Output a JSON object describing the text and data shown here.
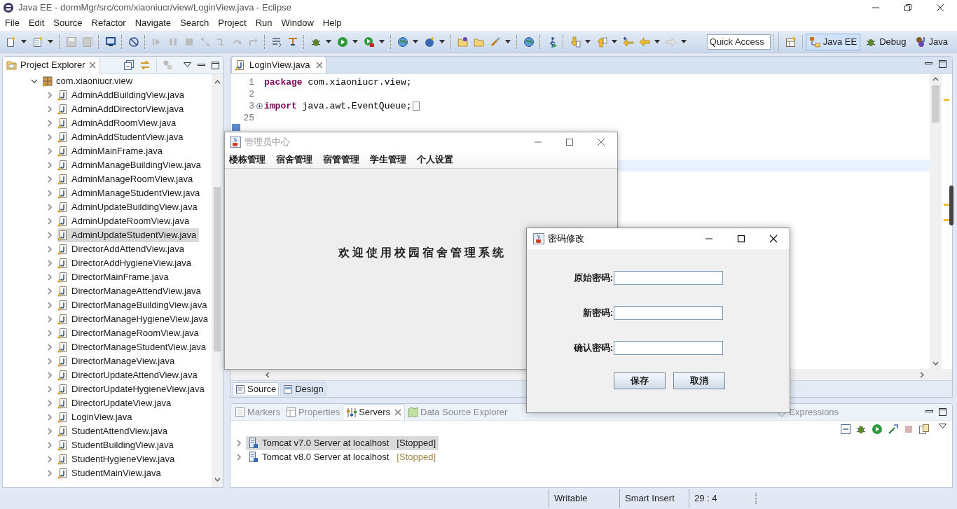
{
  "window": {
    "title": "Java EE - dormMgr/src/com/xiaoniucr/view/LoginView.java - Eclipse"
  },
  "menu_bar": [
    "File",
    "Edit",
    "Source",
    "Refactor",
    "Navigate",
    "Search",
    "Project",
    "Run",
    "Window",
    "Help"
  ],
  "toolbar": {
    "quick_access": {
      "placeholder": "Quick Access"
    },
    "perspectives": [
      {
        "label": "Java EE",
        "selected": true
      },
      {
        "label": "Debug",
        "selected": false
      },
      {
        "label": "Java",
        "selected": false
      }
    ]
  },
  "project_explorer": {
    "title": "Project Explorer",
    "tree": [
      {
        "label": "com.xiaoniucr.view",
        "kind": "package",
        "expanded": true,
        "selected": false,
        "children": [
          {
            "label": "AdminAddBuildingView.java",
            "kind": "file",
            "expanded": false,
            "selected": false
          },
          {
            "label": "AdminAddDirectorView.java",
            "kind": "file",
            "expanded": false,
            "selected": false
          },
          {
            "label": "AdminAddRoomView.java",
            "kind": "file",
            "expanded": false,
            "selected": false
          },
          {
            "label": "AdminAddStudentView.java",
            "kind": "file",
            "expanded": false,
            "selected": false
          },
          {
            "label": "AdminMainFrame.java",
            "kind": "file",
            "expanded": false,
            "selected": false
          },
          {
            "label": "AdminManageBuildingView.java",
            "kind": "file",
            "expanded": false,
            "selected": false
          },
          {
            "label": "AdminManageRoomView.java",
            "kind": "file",
            "expanded": false,
            "selected": false
          },
          {
            "label": "AdminManageStudentView.java",
            "kind": "file",
            "expanded": false,
            "selected": false
          },
          {
            "label": "AdminUpdateBuildingView.java",
            "kind": "file",
            "expanded": false,
            "selected": false
          },
          {
            "label": "AdminUpdateRoomView.java",
            "kind": "file",
            "expanded": false,
            "selected": false
          },
          {
            "label": "AdminUpdateStudentView.java",
            "kind": "file",
            "expanded": false,
            "selected": true
          },
          {
            "label": "DirectorAddAttendView.java",
            "kind": "file",
            "expanded": false,
            "selected": false
          },
          {
            "label": "DirectorAddHygieneView.java",
            "kind": "file",
            "expanded": false,
            "selected": false
          },
          {
            "label": "DirectorMainFrame.java",
            "kind": "file",
            "expanded": false,
            "selected": false
          },
          {
            "label": "DirectorManageAttendView.java",
            "kind": "file",
            "expanded": false,
            "selected": false
          },
          {
            "label": "DirectorManageBuildingView.java",
            "kind": "file",
            "expanded": false,
            "selected": false
          },
          {
            "label": "DirectorManageHygieneView.java",
            "kind": "file",
            "expanded": false,
            "selected": false
          },
          {
            "label": "DirectorManageRoomView.java",
            "kind": "file",
            "expanded": false,
            "selected": false
          },
          {
            "label": "DirectorManageStudentView.java",
            "kind": "file",
            "expanded": false,
            "selected": false
          },
          {
            "label": "DirectorManageView.java",
            "kind": "file",
            "expanded": false,
            "selected": false
          },
          {
            "label": "DirectorUpdateAttendView.java",
            "kind": "file",
            "expanded": false,
            "selected": false
          },
          {
            "label": "DirectorUpdateHygieneView.java",
            "kind": "file",
            "expanded": false,
            "selected": false
          },
          {
            "label": "DirectorUpdateView.java",
            "kind": "file",
            "expanded": false,
            "selected": false
          },
          {
            "label": "LoginView.java",
            "kind": "file",
            "expanded": false,
            "selected": false
          },
          {
            "label": "StudentAttendView.java",
            "kind": "file",
            "expanded": false,
            "selected": false
          },
          {
            "label": "StudentBuildingView.java",
            "kind": "file",
            "expanded": false,
            "selected": false
          },
          {
            "label": "StudentHygieneView.java",
            "kind": "file",
            "expanded": false,
            "selected": false
          },
          {
            "label": "StudentMainView.java",
            "kind": "file",
            "expanded": false,
            "selected": false
          }
        ]
      }
    ]
  },
  "editor": {
    "tabs": [
      {
        "label": "LoginView.java",
        "selected": true
      }
    ],
    "lines": [
      {
        "number": "1",
        "folded": false,
        "tokens": [
          {
            "kind": "keyword",
            "text": "package"
          },
          {
            "kind": "plain",
            "text": " com.xiaoniucr.view;"
          }
        ]
      },
      {
        "number": "2",
        "folded": false
      },
      {
        "number": "3",
        "folded": true,
        "tokens": [
          {
            "kind": "keyword",
            "text": "import"
          },
          {
            "kind": "plain",
            "text": " java.awt.EventQueue;"
          }
        ]
      },
      {
        "number": "25",
        "folded": false
      }
    ],
    "view_tabs": [
      {
        "label": "Source",
        "selected": true
      },
      {
        "label": "Design",
        "selected": false
      }
    ]
  },
  "bottom_panel": {
    "tabs": [
      {
        "label": "Markers",
        "selected": false
      },
      {
        "label": "Properties",
        "selected": false
      },
      {
        "label": "Servers",
        "selected": true
      },
      {
        "label": "Data Source Explorer",
        "selected": false
      },
      {
        "label": "Expressions",
        "selected": false
      }
    ],
    "servers": [
      {
        "label": "Tomcat v7.0 Server at localhost",
        "status": "[Stopped]",
        "selected": true
      },
      {
        "label": "Tomcat v8.0 Server at localhost",
        "status": "[Stopped]",
        "selected": false
      }
    ]
  },
  "status_bar": [
    "Writable",
    "Smart Insert",
    "29 : 4"
  ],
  "admin_window": {
    "title": "管理员中心",
    "active": false,
    "menus": [
      "楼栋管理",
      "宿舍管理",
      "宿管管理",
      "学生管理",
      "个人设置"
    ],
    "welcome": "欢迎使用校园宿舍管理系统"
  },
  "password_dialog": {
    "title": "密码修改",
    "active": true,
    "fields": [
      {
        "label": "原始密码:"
      },
      {
        "label": "新密码:"
      },
      {
        "label": "确认密码:"
      }
    ],
    "buttons": [
      "保存",
      "取消"
    ]
  }
}
